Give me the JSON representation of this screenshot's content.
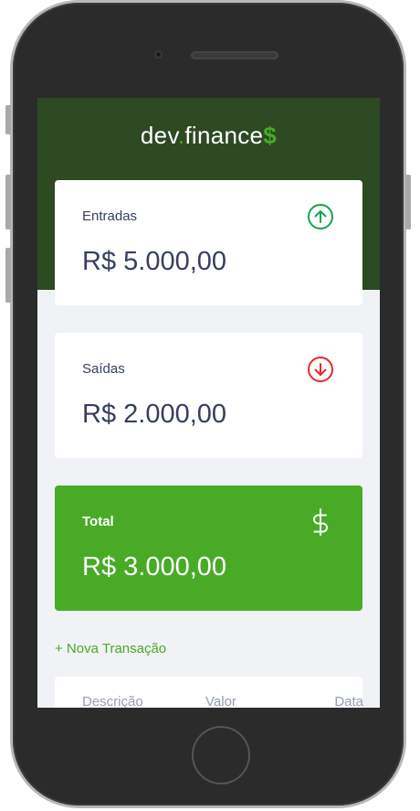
{
  "app": {
    "logo_prefix": "dev",
    "logo_dot": ".",
    "logo_main": "finance",
    "logo_suffix": "$"
  },
  "cards": {
    "income": {
      "label": "Entradas",
      "amount": "R$ 5.000,00",
      "icon": "arrow-up-circle-icon",
      "color": "#12a454"
    },
    "expense": {
      "label": "Saídas",
      "amount": "R$ 2.000,00",
      "icon": "arrow-down-circle-icon",
      "color": "#e92929"
    },
    "total": {
      "label": "Total",
      "amount": "R$ 3.000,00",
      "icon": "dollar-sign-icon",
      "color": "#49aa26"
    }
  },
  "actions": {
    "new_transaction": "+ Nova Transação"
  },
  "table": {
    "headers": [
      "Descrição",
      "Valor",
      "Data"
    ]
  },
  "colors": {
    "header_bg": "#2d4a22",
    "accent": "#49aa26",
    "text": "#363f5f",
    "background": "#f0f2f5"
  }
}
